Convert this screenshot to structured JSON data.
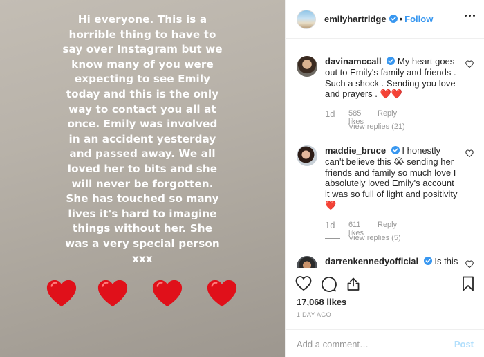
{
  "story": {
    "text": "Hi everyone. This is a\nhorrible thing to have to\nsay over Instagram but we\nknow many of you were\nexpecting to see Emily\ntoday and this is the only\nway to contact you all at\nonce. Emily was involved\nin an accident yesterday\nand passed away. We all\nloved her to bits and she\nwill never be forgotten.\nShe has touched so many\nlives it's hard to imagine\nthings without her. She\nwas a very special person\nxxx",
    "hearts": [
      "red-heart-icon",
      "red-heart-icon",
      "red-heart-icon",
      "red-heart-icon"
    ],
    "heart_color": "#e0101a"
  },
  "header": {
    "username": "emilyhartridge",
    "separator": "•",
    "follow_label": "Follow",
    "verified_icon": "verified-badge-icon",
    "more_icon": "more-options-icon"
  },
  "comments": [
    {
      "username": "davinamccall",
      "verified": true,
      "text": "My heart goes out to Emily's family and friends . Such a shock . Sending you love and prayers . ❤️❤️",
      "time": "1d",
      "likes": "585 likes",
      "reply_label": "Reply",
      "view_replies": "View replies (21)"
    },
    {
      "username": "maddie_bruce",
      "verified": true,
      "text": "I honestly can't believe this 😭 sending her friends and family so much love I absolutely loved Emily's account it was so full of light and positivity ❤️",
      "time": "1d",
      "likes": "611 likes",
      "reply_label": "Reply",
      "view_replies": "View replies (5)"
    },
    {
      "username": "darrenkennedyofficial",
      "verified": true,
      "text": "Is this"
    }
  ],
  "actions": {
    "like_count": "17,068 likes",
    "post_time": "1 DAY AGO",
    "comment_placeholder": "Add a comment…",
    "post_label": "Post"
  },
  "colors": {
    "accent": "#3897f0",
    "verified": "#3897f0",
    "muted": "#999999",
    "post_disabled": "#b2dffc"
  }
}
